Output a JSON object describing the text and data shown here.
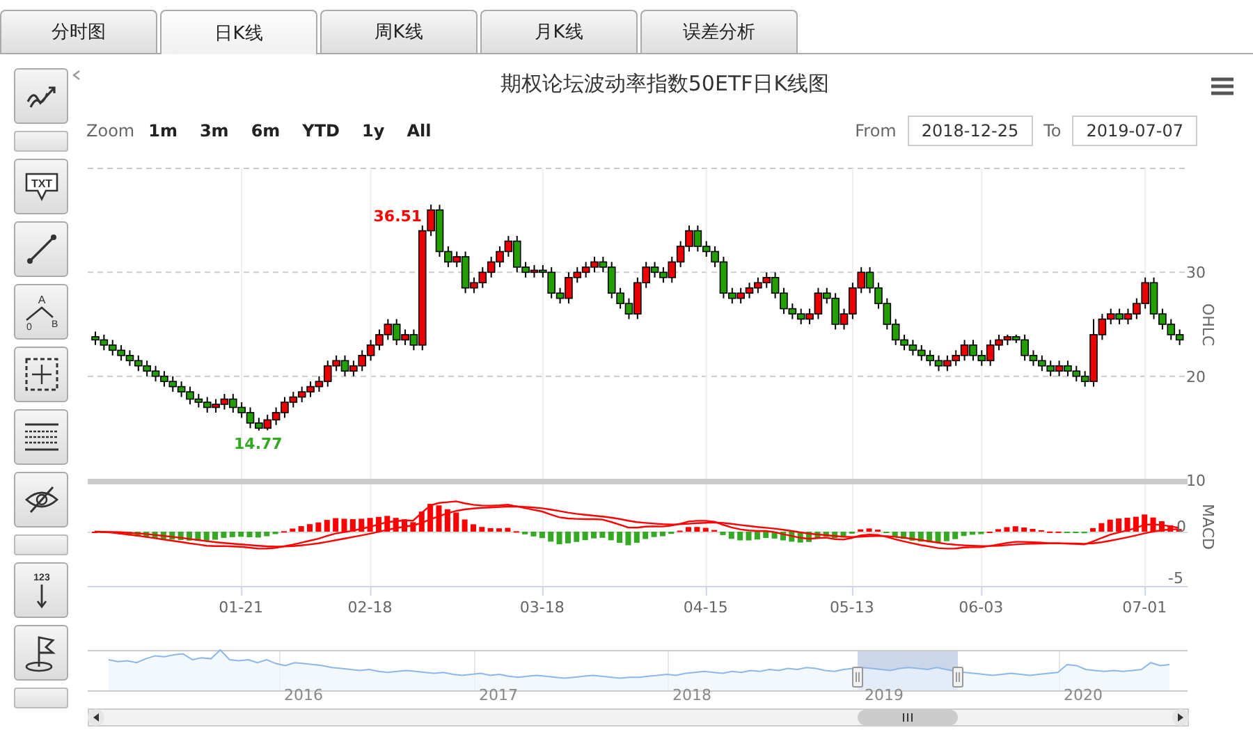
{
  "tabs": [
    {
      "label": "分时图",
      "selected": false
    },
    {
      "label": "日K线",
      "selected": true
    },
    {
      "label": "周K线",
      "selected": false
    },
    {
      "label": "月K线",
      "selected": false
    },
    {
      "label": "误差分析",
      "selected": false
    }
  ],
  "toolbar": [
    {
      "kind": "trend"
    },
    {
      "kind": "separator"
    },
    {
      "kind": "text",
      "label": "TXT"
    },
    {
      "kind": "line"
    },
    {
      "kind": "fib",
      "labels": [
        "A",
        "0",
        "B"
      ]
    },
    {
      "kind": "crosshair"
    },
    {
      "kind": "lines"
    },
    {
      "kind": "hide"
    },
    {
      "kind": "separator"
    },
    {
      "kind": "label",
      "label": "123"
    },
    {
      "kind": "flag"
    },
    {
      "kind": "separator"
    }
  ],
  "chart": {
    "title": "期权论坛波动率指数50ETF日K线图",
    "zoom": {
      "label": "Zoom",
      "buttons": [
        "1m",
        "3m",
        "6m",
        "YTD",
        "1y",
        "All"
      ]
    },
    "range": {
      "from_label": "From",
      "from": "2018-12-25",
      "to_label": "To",
      "to": "2019-07-07"
    },
    "price_ticks": [
      "30",
      "20",
      "10"
    ],
    "chart_data": {
      "type": "candlestick",
      "ylabel": "OHLC",
      "categories": [
        null,
        null,
        null,
        null,
        null,
        null,
        null,
        null,
        null,
        null,
        null,
        null,
        null,
        null,
        null,
        null,
        null,
        "01-21",
        null,
        null,
        null,
        null,
        null,
        null,
        null,
        null,
        null,
        null,
        null,
        null,
        null,
        null,
        "02-18",
        null,
        null,
        null,
        null,
        null,
        null,
        null,
        null,
        null,
        null,
        null,
        null,
        null,
        null,
        null,
        null,
        null,
        null,
        null,
        "03-18",
        null,
        null,
        null,
        null,
        null,
        null,
        null,
        null,
        null,
        null,
        null,
        null,
        null,
        null,
        null,
        null,
        null,
        null,
        "04-15",
        null,
        null,
        null,
        null,
        null,
        null,
        null,
        null,
        null,
        null,
        null,
        null,
        null,
        null,
        null,
        null,
        "05-13",
        null,
        null,
        null,
        null,
        null,
        null,
        null,
        null,
        null,
        null,
        null,
        null,
        null,
        null,
        "06-03",
        null,
        null,
        null,
        null,
        null,
        null,
        null,
        null,
        null,
        null,
        null,
        null,
        null,
        null,
        null,
        null,
        null,
        null,
        "07-01",
        null,
        null,
        null,
        null
      ],
      "annotations": [
        "36.51",
        "14.77"
      ],
      "ohlc": [
        [
          23.8,
          24.3,
          23,
          23.5
        ],
        [
          23.5,
          24,
          22.5,
          23
        ],
        [
          23,
          23.5,
          22,
          22.5
        ],
        [
          22.5,
          23,
          21.5,
          22
        ],
        [
          22,
          22.5,
          21,
          21.5
        ],
        [
          21.5,
          22,
          20.5,
          21
        ],
        [
          21,
          21.5,
          20,
          20.5
        ],
        [
          20.5,
          21,
          19.5,
          20
        ],
        [
          20,
          20.5,
          19,
          19.5
        ],
        [
          19.5,
          20,
          18.5,
          19
        ],
        [
          19,
          19.5,
          18,
          18.5
        ],
        [
          18.5,
          19,
          17.3,
          17.8
        ],
        [
          17.8,
          18.3,
          17,
          17.5
        ],
        [
          17.5,
          18,
          16.5,
          17
        ],
        [
          17,
          17.8,
          16.5,
          17.3
        ],
        [
          17.3,
          18.3,
          16.8,
          17.8
        ],
        [
          17.8,
          18.3,
          16.5,
          17
        ],
        [
          17,
          17.5,
          16,
          16.5
        ],
        [
          16.5,
          17,
          15,
          15.5
        ],
        [
          15.5,
          16,
          14.77,
          15
        ],
        [
          15,
          16.3,
          14.8,
          15.8
        ],
        [
          15.8,
          17,
          15.3,
          16.5
        ],
        [
          16.5,
          18,
          16,
          17.5
        ],
        [
          17.5,
          18.5,
          17,
          18
        ],
        [
          18,
          19,
          17.5,
          18.5
        ],
        [
          18.5,
          19.5,
          18,
          19
        ],
        [
          19,
          20,
          18.5,
          19.5
        ],
        [
          19.5,
          21.5,
          19,
          21
        ],
        [
          21,
          22,
          20.5,
          21.5
        ],
        [
          21.5,
          22,
          20,
          20.5
        ],
        [
          20.5,
          21.5,
          20,
          21
        ],
        [
          21,
          22.5,
          20.5,
          22
        ],
        [
          22,
          23.5,
          21.5,
          23
        ],
        [
          23,
          24.5,
          22.5,
          24
        ],
        [
          24,
          25.5,
          23.5,
          25
        ],
        [
          25,
          25.5,
          23,
          23.5
        ],
        [
          23.5,
          24.5,
          23,
          24
        ],
        [
          24,
          24.5,
          22.5,
          23
        ],
        [
          23,
          34.5,
          22.5,
          34
        ],
        [
          34,
          36.51,
          33.5,
          36
        ],
        [
          36,
          36.5,
          31.5,
          32
        ],
        [
          32,
          32.5,
          30.5,
          31
        ],
        [
          31,
          32,
          30.5,
          31.5
        ],
        [
          31.5,
          32,
          28,
          28.5
        ],
        [
          28.5,
          29.5,
          28,
          29
        ],
        [
          29,
          30.5,
          28.5,
          30
        ],
        [
          30,
          31.5,
          29.5,
          31
        ],
        [
          31,
          32.5,
          30.5,
          32
        ],
        [
          32,
          33.5,
          31.5,
          33
        ],
        [
          33,
          33.5,
          30,
          30.5
        ],
        [
          30.5,
          31,
          29.5,
          30
        ],
        [
          30,
          30.7,
          29.5,
          30.2
        ],
        [
          30.2,
          30.7,
          29.5,
          30
        ],
        [
          30,
          30.5,
          27.5,
          28
        ],
        [
          28,
          28.5,
          27,
          27.5
        ],
        [
          27.5,
          30,
          27,
          29.5
        ],
        [
          29.5,
          30.5,
          29,
          30
        ],
        [
          30,
          31,
          29.5,
          30.5
        ],
        [
          30.5,
          31.5,
          30,
          31
        ],
        [
          31,
          31.5,
          30,
          30.5
        ],
        [
          30.5,
          31,
          27.5,
          28
        ],
        [
          28,
          28.5,
          26.5,
          27
        ],
        [
          27,
          27.5,
          25.5,
          26
        ],
        [
          26,
          29.5,
          25.5,
          29
        ],
        [
          29,
          31,
          28.5,
          30.5
        ],
        [
          30.5,
          31,
          29.5,
          30
        ],
        [
          30,
          30.5,
          29,
          29.5
        ],
        [
          29.5,
          31.5,
          29,
          31
        ],
        [
          31,
          33,
          30.5,
          32.5
        ],
        [
          32.5,
          34.5,
          32,
          34
        ],
        [
          34,
          34.5,
          32,
          32.5
        ],
        [
          32.5,
          33,
          31.5,
          32
        ],
        [
          32,
          32.5,
          30.5,
          31
        ],
        [
          31,
          31.5,
          27.5,
          28
        ],
        [
          28,
          28.5,
          27,
          27.5
        ],
        [
          27.5,
          28.5,
          27,
          28
        ],
        [
          28,
          29,
          27.5,
          28.5
        ],
        [
          28.5,
          29.5,
          28,
          29
        ],
        [
          29,
          30,
          28.5,
          29.5
        ],
        [
          29.5,
          30,
          27.5,
          28
        ],
        [
          28,
          28.5,
          26,
          26.5
        ],
        [
          26.5,
          27,
          25.5,
          26
        ],
        [
          26,
          26.5,
          25,
          25.5
        ],
        [
          25.5,
          26.5,
          25,
          26
        ],
        [
          26,
          28.5,
          25.5,
          28
        ],
        [
          28,
          28.5,
          27,
          27.5
        ],
        [
          27.5,
          28,
          24.5,
          25
        ],
        [
          25,
          26.5,
          24.5,
          26
        ],
        [
          26,
          29,
          25.5,
          28.5
        ],
        [
          28.5,
          30.5,
          28,
          30
        ],
        [
          30,
          30.5,
          28,
          28.5
        ],
        [
          28.5,
          29,
          26.5,
          27
        ],
        [
          27,
          27.5,
          24.5,
          25
        ],
        [
          25,
          25.5,
          23,
          23.5
        ],
        [
          23.5,
          24,
          22.5,
          23
        ],
        [
          23,
          23.5,
          22,
          22.5
        ],
        [
          22.5,
          23,
          21.5,
          22
        ],
        [
          22,
          22.5,
          21,
          21.5
        ],
        [
          21.5,
          22,
          20.5,
          21
        ],
        [
          21,
          22,
          20.5,
          21.5
        ],
        [
          21.5,
          22.5,
          21,
          22
        ],
        [
          22,
          23.5,
          21.5,
          23
        ],
        [
          23,
          23.5,
          21.5,
          22
        ],
        [
          22,
          22.5,
          21,
          21.5
        ],
        [
          21.5,
          23.5,
          21,
          23
        ],
        [
          23,
          24,
          22.5,
          23.5
        ],
        [
          23.5,
          24,
          23,
          23.8
        ],
        [
          23.8,
          24,
          23.2,
          23.5
        ],
        [
          23.5,
          24,
          21.5,
          22
        ],
        [
          22,
          22.5,
          21,
          21.5
        ],
        [
          21.5,
          22,
          20.5,
          21
        ],
        [
          21,
          21.5,
          20,
          20.5
        ],
        [
          20.5,
          21.5,
          20,
          21
        ],
        [
          21,
          21.5,
          20,
          20.5
        ],
        [
          20.5,
          21,
          19.5,
          20
        ],
        [
          20,
          20.5,
          19,
          19.5
        ],
        [
          19.5,
          25.5,
          19,
          24
        ],
        [
          24,
          26,
          23.5,
          25.5
        ],
        [
          25.5,
          26.5,
          25,
          26
        ],
        [
          26,
          26.5,
          25,
          25.5
        ],
        [
          25.5,
          26.5,
          25,
          26
        ],
        [
          26,
          27.5,
          25.5,
          27
        ],
        [
          27,
          29.5,
          26.5,
          29
        ],
        [
          29,
          29.5,
          25.5,
          26
        ],
        [
          26,
          26.5,
          24.5,
          25
        ],
        [
          25,
          25.5,
          23.5,
          24
        ],
        [
          24,
          24.5,
          23,
          23.5
        ]
      ]
    },
    "macd_axis": {
      "title": "MACD",
      "ticks": [
        "0",
        "-5"
      ]
    },
    "navigator": {
      "years": [
        "2016",
        "2017",
        "2018",
        "2019",
        "2020"
      ]
    }
  }
}
